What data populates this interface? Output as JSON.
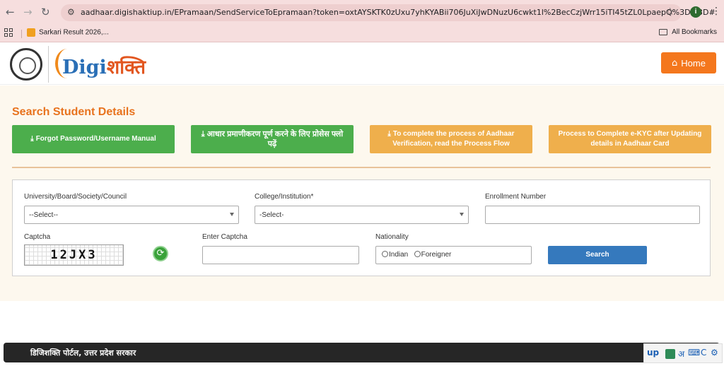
{
  "browser": {
    "url": "aadhaar.digishaktiup.in/EPramaan/SendServiceToEpramaan?token=oxtAYSKTK0zUxu7yhKYABii706JuXiJwDNuzU6cwkt1l%2BecCzjWrr15iTI45tZL0LpaepQ%3D%3D#",
    "profile_initial": "i",
    "bookmark_item": "Sarkari Result 2026,...",
    "all_bookmarks": "All Bookmarks"
  },
  "header": {
    "logo_latin": "Digi",
    "logo_hindi": "शक्ति",
    "home_label": "Home"
  },
  "main": {
    "title": "Search Student Details",
    "buttons": [
      {
        "label": "Forgot Password/Username Manual",
        "icon": "download-icon",
        "color": "#4cae4c"
      },
      {
        "label": "आधार प्रमाणीकरण पूर्ण करने के लिए प्रोसेस फ्लो पढ़ें",
        "icon": "download-icon",
        "color": "#4cae4c"
      },
      {
        "label": "To complete the process of Aadhaar Verification, read the Process Flow",
        "icon": "download-icon",
        "color": "#efaf4c"
      },
      {
        "label": "Process to Complete e-KYC after Updating details in Aadhaar Card",
        "icon": "",
        "color": "#efaf4c"
      }
    ],
    "form": {
      "university_label": "University/Board/Society/Council",
      "university_value": "--Select--",
      "college_label": "College/Institution*",
      "college_value": "-Select-",
      "enrollment_label": "Enrollment Number",
      "enrollment_value": "",
      "captcha_label": "Captcha",
      "captcha_text": "12JX3",
      "enter_captcha_label": "Enter Captcha",
      "enter_captcha_value": "",
      "nationality_label": "Nationality",
      "nationality_options": [
        "Indian",
        "Foreigner"
      ],
      "search_label": "Search"
    }
  },
  "footer": {
    "text": "डिजिशक्ति पोर्टल, उत्तर प्रदेश सरकार"
  },
  "ime": {
    "brand": "up",
    "lang_char": "अ",
    "key": "C"
  },
  "colors": {
    "accent_orange": "#f4771d",
    "title_orange": "#e8731e",
    "search_blue": "#3579bd",
    "footer_dark": "#262626"
  }
}
